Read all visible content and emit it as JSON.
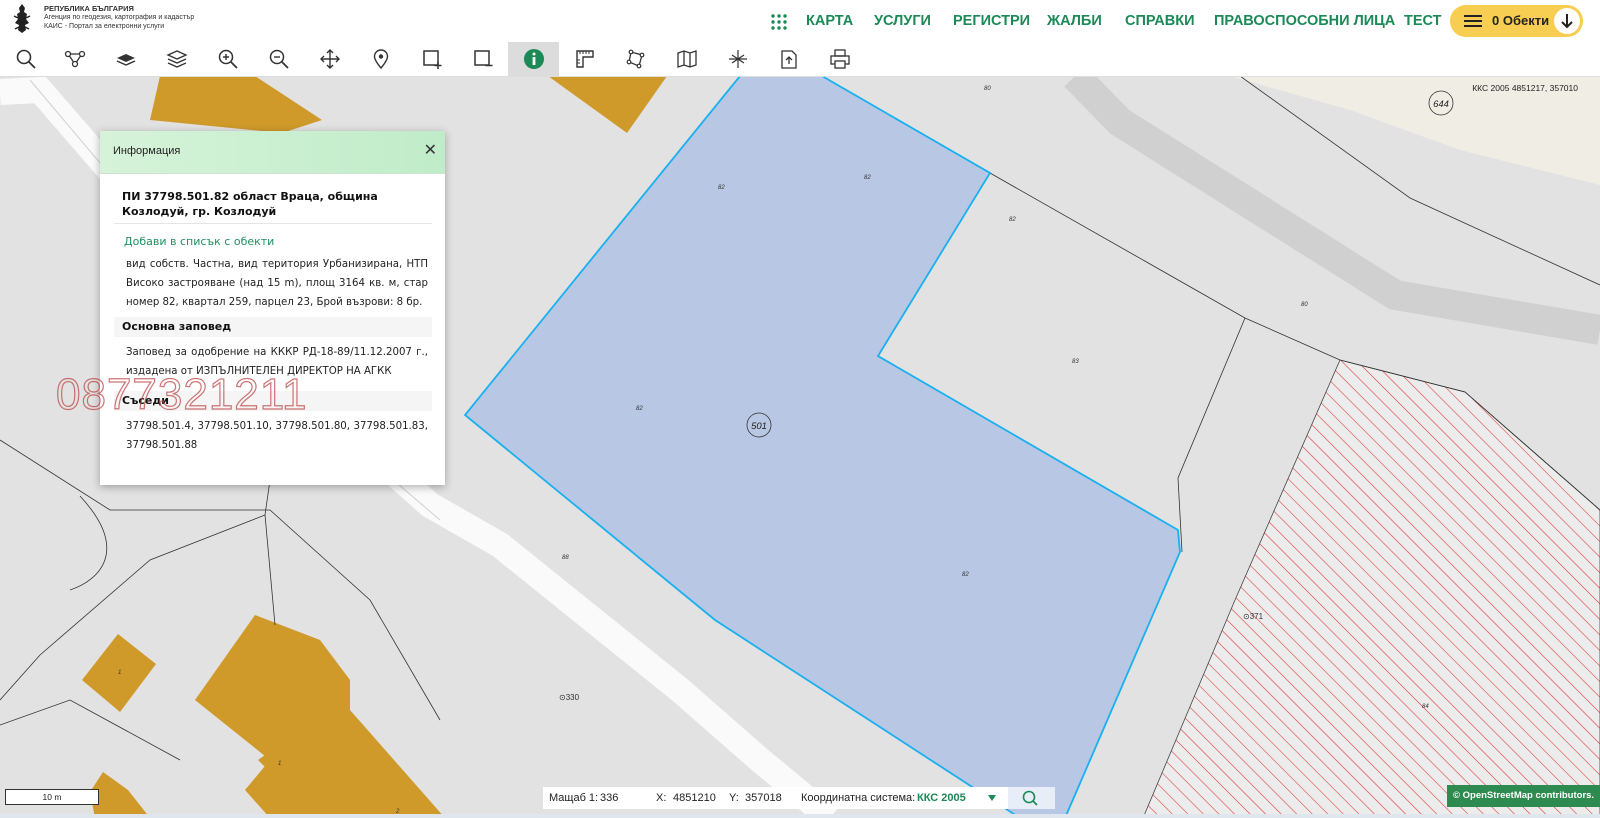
{
  "header": {
    "logo_lines": [
      "РЕПУБЛИКА БЪЛГАРИЯ",
      "Агенция по геодезия, картография и кадастър",
      "КАИС - Портал за електронни услуги"
    ],
    "nav": [
      "КАРТА",
      "УСЛУГИ",
      "РЕГИСТРИ",
      "ЖАЛБИ",
      "СПРАВКИ",
      "ПРАВОСПОСОБНИ ЛИЦА",
      "ТЕСТ"
    ],
    "cart_label": "0 Обекти",
    "colors": {
      "brand_green": "#1b8a57",
      "cart_yellow": "#f7cd52"
    }
  },
  "toolbar": {
    "tools": [
      "search-icon",
      "route-icon",
      "layer-icon",
      "layers-icon",
      "zoom-in-icon",
      "zoom-out-icon",
      "pan-icon",
      "marker-icon",
      "rectangle-select-icon",
      "rectangle-deselect-icon",
      "info-icon",
      "measure-icon",
      "polygon-icon",
      "map-icon",
      "intersect-icon",
      "export-icon",
      "print-icon"
    ],
    "active": "info-icon"
  },
  "popup": {
    "title": "Информация",
    "close": "✕",
    "parcel_title": "ПИ 37798.501.82 област Враца, община Козлодуй, гр. Козлодуй",
    "add_link": "Добави в списък с обекти",
    "description": "вид собств. Частна, вид територия Урбанизирана, НТП Високо застрояване (над 15 m), площ 3164 кв. м, стар номер 82, квартал 259, парцел 23, Брой възрови: 8 бр.",
    "section_order_title": "Основна заповед",
    "order_text": "Заповед за одобрение на КККР РД-18-89/11.12.2007 г., издадена от ИЗПЪЛНИТЕЛЕН ДИРЕКТОР НА АГКК",
    "section_neighbors_title": "Съседи",
    "neighbors_text": "37798.501.4, 37798.501.10, 37798.501.80, 37798.501.83, 37798.501.88"
  },
  "watermark": "0877321211",
  "map": {
    "coord_system_label": "ККС 2005 4851217, 357010",
    "labels": {
      "plan_501": "501",
      "plan_644": "644",
      "p82a": "82",
      "p82b": "82",
      "p82c": "82",
      "p82d": "82",
      "p82e": "82",
      "p80a": "80",
      "p80b": "80",
      "p83": "83",
      "p88": "88",
      "p84": "84",
      "p1a": "1",
      "p1b": "1",
      "p2": "2",
      "b330": "⊙330",
      "b371": "⊙371"
    },
    "colors": {
      "selected_fill": "#b8c7e3",
      "selected_stroke": "#1ab0f0",
      "building": "#cf9a2a",
      "hatch": "#e03030"
    }
  },
  "scale_bar": "10 m",
  "status": {
    "scale_label": "Мащаб 1:",
    "scale_value": "336",
    "x_label": "X:",
    "x_value": "4851210",
    "y_label": "Y:",
    "y_value": "357018",
    "system_label": "Координатна система:",
    "system_value": "ККС 2005"
  },
  "attribution": "© OpenStreetMap contributors."
}
